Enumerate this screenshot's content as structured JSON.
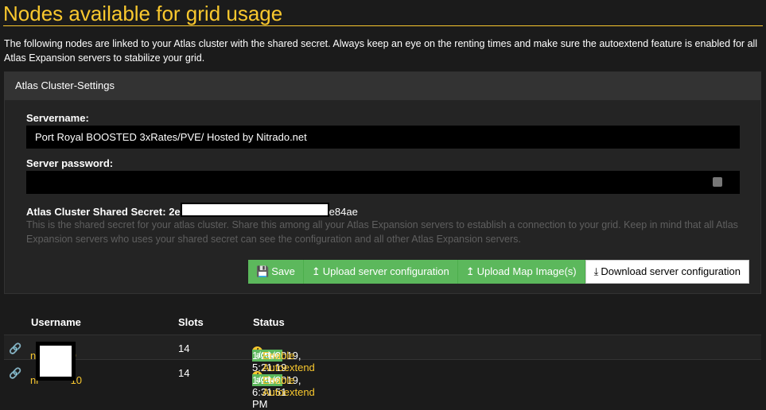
{
  "page": {
    "title": "Nodes available for grid usage",
    "intro": "The following nodes are linked to your Atlas cluster with the shared secret. Always keep an eye on the renting times and make sure the autoextend feature is enabled for all Atlas Expansion servers to stabilize your grid."
  },
  "panel": {
    "header": "Atlas Cluster-Settings",
    "servername_label": "Servername:",
    "servername_value": "Port Royal BOOSTED 3xRates/PVE/ Hosted by Nitrado.net",
    "password_label": "Server password:",
    "password_value": "",
    "secret_label": "Atlas Cluster Shared Secret:",
    "secret_prefix": "2e",
    "secret_suffix": "e84ae",
    "help": "This is the shared secret for your atlas cluster. Share this among all your Atlas Expansion servers to establish a connection to your grid. Keep in mind that all Atlas Expansion servers who uses your shared secret can see the configuration and all other Atlas Expansion servers.",
    "buttons": {
      "save": "Save",
      "upload_config": "Upload server configuration",
      "upload_map": "Upload Map Image(s)",
      "download_config": "Download server configuration"
    }
  },
  "table": {
    "headers": [
      "Username",
      "Slots",
      "Status"
    ],
    "rows": [
      {
        "user_prefix": "ni",
        "user_suffix": "9",
        "slots": "14",
        "badge": "active",
        "time": "1/21/2019, 5:21:19 PM",
        "action": "Enable Autoextend"
      },
      {
        "user_prefix": "ni",
        "user_suffix": "10",
        "slots": "14",
        "badge": "active",
        "time": "1/21/2019, 6:31:51 PM",
        "action": "Enable Autoextend"
      }
    ]
  },
  "colors": {
    "accent": "#f9c82e",
    "success": "#5cb85c",
    "background": "#1b1b1b"
  }
}
